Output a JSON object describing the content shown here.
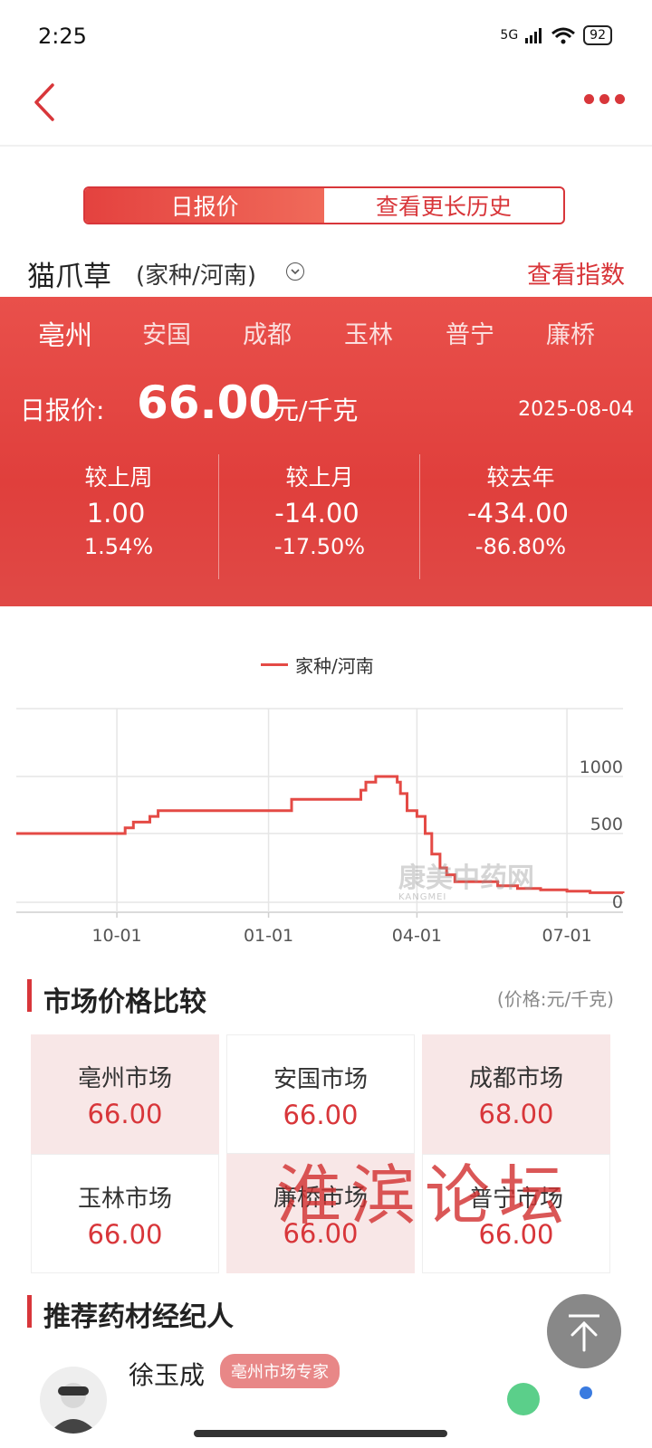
{
  "status_bar": {
    "time": "2:25",
    "network": "5G",
    "wifi_sub": "6",
    "battery": "92"
  },
  "tabs": [
    {
      "label": "日报价",
      "active": true
    },
    {
      "label": "查看更长历史",
      "active": false
    }
  ],
  "herb": {
    "name": "猫爪草",
    "spec": "(家种/河南)",
    "view_index": "查看指数"
  },
  "markets": [
    "亳州",
    "安国",
    "成都",
    "玉林",
    "普宁",
    "廉桥"
  ],
  "price": {
    "label": "日报价:",
    "value": "66.00",
    "unit": "元/千克",
    "date": "2025-08-04"
  },
  "comparisons": [
    {
      "title": "较上周",
      "value": "1.00",
      "direction": "up",
      "pct": "1.54%"
    },
    {
      "title": "较上月",
      "value": "-14.00",
      "direction": "down",
      "pct": "-17.50%"
    },
    {
      "title": "较去年",
      "value": "-434.00",
      "direction": "down",
      "pct": "-86.80%"
    }
  ],
  "chart_data": {
    "type": "line",
    "legend": [
      "家种/河南"
    ],
    "series": [
      {
        "name": "家种/河南",
        "color": "#e44a45",
        "x": [
          "2024-08-01",
          "2024-10-01",
          "2024-10-06",
          "2024-10-11",
          "2024-10-21",
          "2024-10-26",
          "2024-12-16",
          "2025-01-01",
          "2025-01-15",
          "2025-02-24",
          "2025-02-26",
          "2025-03-01",
          "2025-03-07",
          "2025-03-14",
          "2025-03-20",
          "2025-03-22",
          "2025-03-26",
          "2025-04-01",
          "2025-04-06",
          "2025-04-10",
          "2025-04-15",
          "2025-04-19",
          "2025-04-24",
          "2025-05-01",
          "2025-05-10",
          "2025-05-20",
          "2025-06-01",
          "2025-06-15",
          "2025-07-01",
          "2025-07-15",
          "2025-08-04"
        ],
        "values": [
          500,
          500,
          550,
          600,
          650,
          700,
          700,
          700,
          800,
          800,
          880,
          950,
          1000,
          1000,
          950,
          850,
          700,
          650,
          500,
          350,
          250,
          200,
          150,
          150,
          150,
          120,
          100,
          90,
          80,
          70,
          66
        ]
      }
    ],
    "xticks": [
      "10-01",
      "01-01",
      "04-01",
      "07-01"
    ],
    "yticks": [
      0,
      500,
      1000
    ],
    "ylim": [
      0,
      1000
    ],
    "grid": true,
    "legend_position": "top-center"
  },
  "watermark": {
    "text": "康美中药网",
    "sub": "KANGMEI"
  },
  "market_compare": {
    "title": "市场价格比较",
    "unit_note": "(价格:元/千克)",
    "cells": [
      {
        "name": "亳州市场",
        "price": "66.00",
        "highlight": true
      },
      {
        "name": "安国市场",
        "price": "66.00",
        "highlight": false
      },
      {
        "name": "成都市场",
        "price": "68.00",
        "highlight": true
      },
      {
        "name": "玉林市场",
        "price": "66.00",
        "highlight": false
      },
      {
        "name": "廉桥市场",
        "price": "66.00",
        "highlight": true
      },
      {
        "name": "普宁市场",
        "price": "66.00",
        "highlight": false
      }
    ]
  },
  "forum_watermark": "淮滨论坛",
  "broker_section": {
    "title": "推荐药材经纪人",
    "name": "徐玉成",
    "badge": "亳州市场专家"
  },
  "colors": {
    "accent": "#d8363a",
    "panel": "#e34541",
    "pink_cell": "#f8e7e7"
  }
}
